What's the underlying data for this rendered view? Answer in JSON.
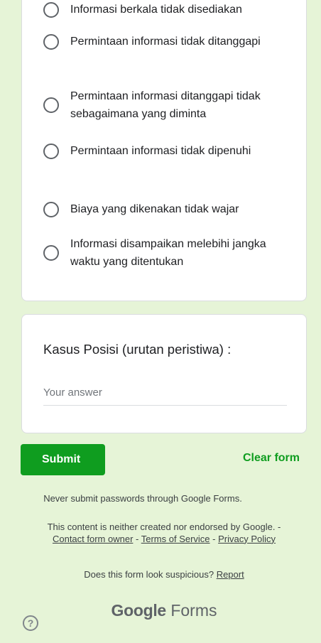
{
  "options": [
    "Informasi berkala tidak disediakan",
    "Permintaan informasi tidak ditanggapi",
    "Permintaan informasi ditanggapi tidak sebagaimana yang diminta",
    "Permintaan informasi tidak dipenuhi",
    "Biaya yang dikenakan tidak wajar",
    "Informasi disampaikan melebihi jangka waktu yang ditentukan"
  ],
  "question": {
    "title": "Kasus Posisi (urutan peristiwa)  :",
    "placeholder": "Your answer"
  },
  "actions": {
    "submit_label": "Submit",
    "clear_label": "Clear form"
  },
  "footer": {
    "never_submit": "Never submit passwords through Google Forms.",
    "disclaimer_prefix": "This content is neither created nor endorsed by Google. - ",
    "contact_owner": "Contact form owner",
    "sep1": " - ",
    "terms": "Terms of Service",
    "sep2": " - ",
    "privacy": "Privacy Policy",
    "suspicious_prefix": "Does this form look suspicious? ",
    "report": "Report",
    "brand_google": "Google",
    "brand_forms": "Forms"
  },
  "icons": {
    "help": "help-icon",
    "radio": "radio-unchecked-icon"
  },
  "colors": {
    "background": "#e6f4d7",
    "accent": "#0f9d1f"
  }
}
